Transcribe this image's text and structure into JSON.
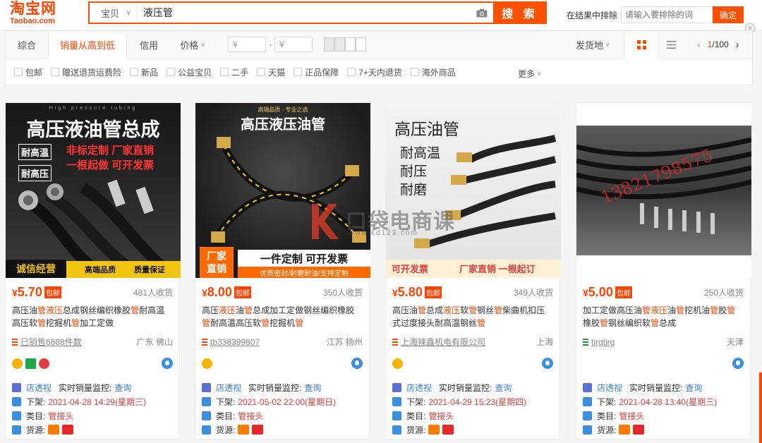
{
  "header": {
    "logo_cn": "淘宝网",
    "logo_en": "Taobao.com",
    "search_category": "宝贝",
    "search_value": "液压管",
    "search_button": "搜 索",
    "exclude_label": "在结果中排除",
    "exclude_placeholder": "请输入要排除的词",
    "exclude_ok": "确定"
  },
  "sort": {
    "tabs": [
      "综合",
      "销量从高到低",
      "信用",
      "价格"
    ],
    "price_min": "¥",
    "price_dash": "-",
    "price_max": "¥",
    "ship_from": "发货地",
    "page_current": "1",
    "page_total": "/100"
  },
  "checkbox_filters": [
    "包邮",
    "赠送退货运费险",
    "新品",
    "公益宝贝",
    "二手",
    "天猫",
    "正品保障",
    "7+天内退货",
    "海外商品"
  ],
  "more_label": "更多",
  "products": [
    {
      "price": "5.70",
      "baoyou": "包邮",
      "sold": "481人收货",
      "title_parts": [
        "高压油",
        "管",
        "液压",
        "总成钢丝编织橡胶",
        "管",
        "耐高温高压软",
        "管",
        "挖掘机",
        "管",
        "加工定做"
      ],
      "shop": "已销售6888件数",
      "location": "广东 佛山",
      "img_title": "高压液油管总成",
      "img_sub": "High pressure tubing",
      "img_tags": [
        "耐高温",
        "耐高压"
      ],
      "img_slogans": [
        "非标定制 厂家直销",
        "一根起做 可开发票"
      ],
      "img_foot": [
        "诚信经营",
        "高端品质",
        "质量保证"
      ]
    },
    {
      "price": "8.00",
      "baoyou": "包邮",
      "sold": "350人收货",
      "title_parts": [
        "高压",
        "液压",
        "油",
        "管",
        "总成加工定做钢丝编织橡胶",
        "管",
        "耐高温高压软",
        "管",
        "挖掘机",
        "管"
      ],
      "shop": "tb338399807",
      "location": "江苏 扬州",
      "img_title": "高压液压油管",
      "img_sub": "高端品质 · 专业之选",
      "img_tags": [
        "厂家",
        "直销"
      ],
      "img_slogans": [
        "一件定制 可开发票"
      ],
      "img_foot": [
        "优质密封/耐磨耐油/支持定制"
      ]
    },
    {
      "price": "5.80",
      "baoyou": "包邮",
      "sold": "349人收货",
      "title_parts": [
        "高压油",
        "管",
        "总成",
        "液压",
        "软",
        "管",
        "钢丝",
        "管",
        "柴曲机扣压式过度接头耐高温钢丝",
        "管"
      ],
      "shop": "上海辣鑫机电有限公司",
      "location": "上海",
      "img_title": "高压油管",
      "img_sub": "",
      "img_tags": [
        "耐高温",
        "耐压",
        "耐磨"
      ],
      "img_slogans": [],
      "img_foot": [
        "可开发票",
        "厂家直销 一根起订"
      ]
    },
    {
      "price": "5.00",
      "baoyou": "包邮",
      "sold": "250人收货",
      "title_parts": [
        "加工定做高压油",
        "管",
        "液压",
        "油",
        "管",
        "挖机油",
        "管",
        "胶",
        "管",
        "橡胶",
        "管",
        "钢丝编织软",
        "管",
        "总成"
      ],
      "shop": "tjrgtjrg",
      "location": "天津",
      "img_title": "",
      "img_sub": "",
      "img_overlay": "13821798575",
      "img_tags": [],
      "img_slogans": [],
      "img_foot": []
    }
  ],
  "plugin": {
    "dtx": "店透视",
    "monitor": "实时销量监控:",
    "query": "查询",
    "off_label": "下架:",
    "cat_label": "类目:",
    "cat_value": "管接头",
    "src_label": "货源:",
    "off_times": [
      "2021-04-28 14:29(星期三)",
      "2021-05-02 22:00(星期日)",
      "2021-04-29 15:23(星期四)",
      "2021-04-28 13:40(星期三)"
    ]
  },
  "watermark": {
    "text": "口袋电商课",
    "url": "www.kd123.com"
  },
  "colors": {
    "accent": "#ff5000",
    "price": "#ff4400",
    "link": "#3a7ee0"
  }
}
